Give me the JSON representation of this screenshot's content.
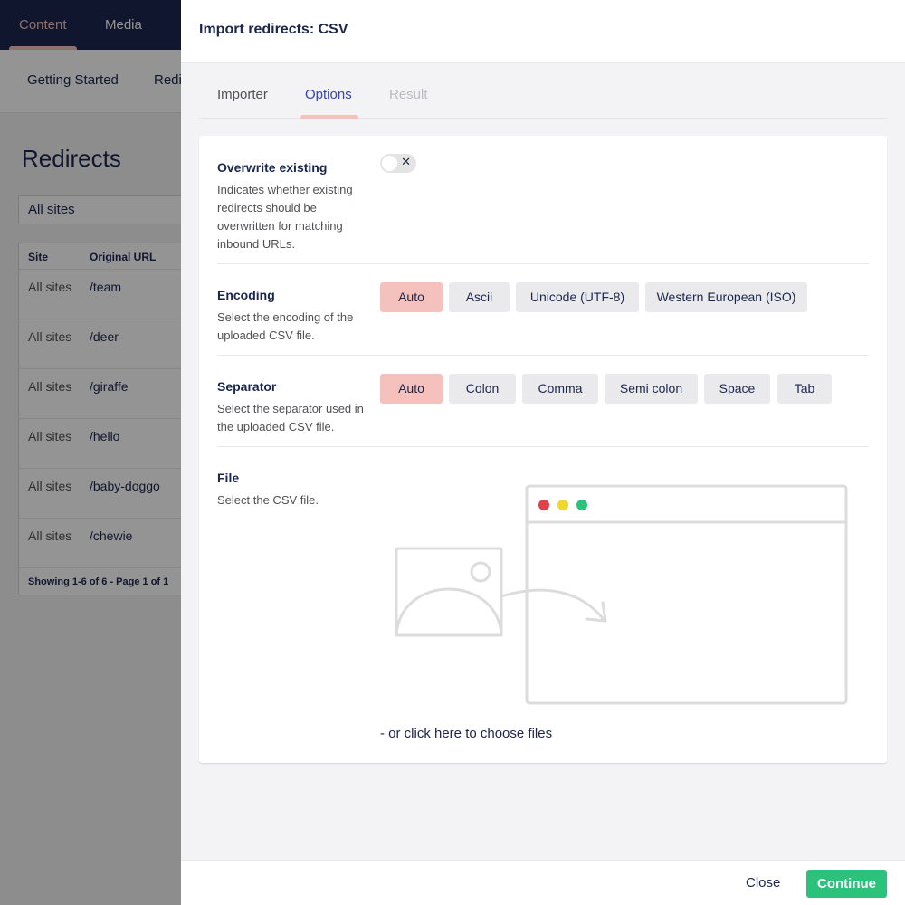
{
  "background": {
    "top_nav": [
      "Content",
      "Media"
    ],
    "sub_nav": [
      "Getting Started",
      "Redi"
    ],
    "page_title": "Redirects",
    "site_filter": "All sites",
    "table": {
      "headers": [
        "Site",
        "Original URL"
      ],
      "rows": [
        {
          "site": "All sites",
          "url": "/team"
        },
        {
          "site": "All sites",
          "url": "/deer"
        },
        {
          "site": "All sites",
          "url": "/giraffe"
        },
        {
          "site": "All sites",
          "url": "/hello"
        },
        {
          "site": "All sites",
          "url": "/baby-doggo"
        },
        {
          "site": "All sites",
          "url": "/chewie"
        }
      ],
      "footer": "Showing 1-6 of 6 - Page 1 of 1"
    }
  },
  "dialog": {
    "title": "Import redirects: CSV",
    "tabs": [
      {
        "label": "Importer",
        "state": "normal"
      },
      {
        "label": "Options",
        "state": "active"
      },
      {
        "label": "Result",
        "state": "disabled"
      }
    ],
    "overwrite": {
      "label": "Overwrite existing",
      "description": "Indicates whether existing redirects should be overwritten for matching inbound URLs.",
      "enabled": false,
      "toggle_icon": "close-icon"
    },
    "encoding": {
      "label": "Encoding",
      "description": "Select the encoding of the uploaded CSV file.",
      "options": [
        "Auto",
        "Ascii",
        "Unicode (UTF-8)",
        "Western European (ISO)"
      ],
      "selected": "Auto"
    },
    "separator": {
      "label": "Separator",
      "description": "Select the separator used in the uploaded CSV file.",
      "options": [
        "Auto",
        "Colon",
        "Comma",
        "Semi colon",
        "Space",
        "Tab"
      ],
      "selected": "Auto"
    },
    "file": {
      "label": "File",
      "description": "Select the CSV file.",
      "choose_text": "- or click here to choose files"
    },
    "footer": {
      "close_label": "Close",
      "continue_label": "Continue"
    }
  },
  "colors": {
    "nav_bg": "#1b264f",
    "accent_pink": "#f5c1bc",
    "active_tab": "#3544b1",
    "continue_green": "#2bc37c",
    "dot_red": "#e0414b",
    "dot_yellow": "#f2d62e",
    "dot_green": "#2bc37c"
  }
}
